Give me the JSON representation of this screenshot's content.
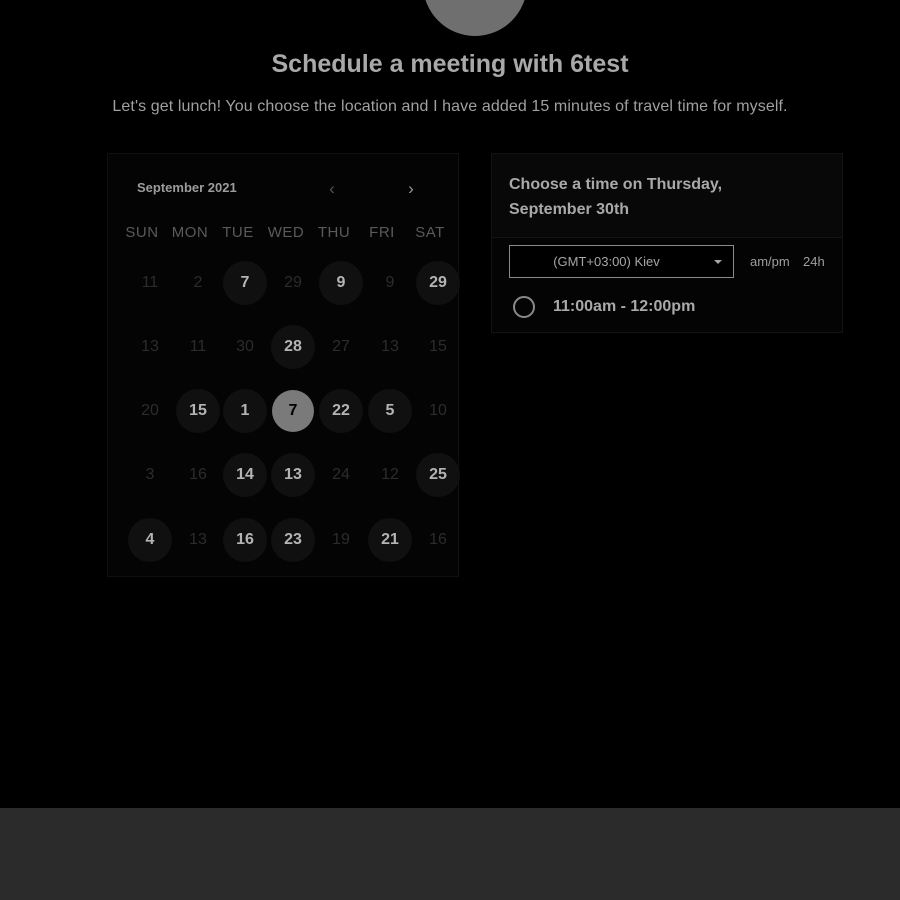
{
  "header": {
    "title": "Schedule a meeting with 6test",
    "subtitle": "Let's get lunch! You choose the location and I have added 15 minutes of travel time for myself."
  },
  "calendar": {
    "month_label": "September 2021",
    "prev_icon": "chevron-left-icon",
    "next_icon": "chevron-right-icon",
    "weekdays": [
      "SUN",
      "MON",
      "TUE",
      "WED",
      "THU",
      "FRI",
      "SAT"
    ],
    "weeks": [
      [
        {
          "d": "11",
          "s": "disabled"
        },
        {
          "d": "2",
          "s": "disabled"
        },
        {
          "d": "7",
          "s": "active"
        },
        {
          "d": "29",
          "s": "disabled"
        },
        {
          "d": "9",
          "s": "active"
        },
        {
          "d": "9",
          "s": "disabled"
        },
        {
          "d": "29",
          "s": "active"
        }
      ],
      [
        {
          "d": "13",
          "s": "disabled"
        },
        {
          "d": "11",
          "s": "disabled"
        },
        {
          "d": "30",
          "s": "disabled"
        },
        {
          "d": "28",
          "s": "active"
        },
        {
          "d": "27",
          "s": "disabled"
        },
        {
          "d": "13",
          "s": "disabled"
        },
        {
          "d": "15",
          "s": "disabled"
        }
      ],
      [
        {
          "d": "20",
          "s": "disabled"
        },
        {
          "d": "15",
          "s": "active"
        },
        {
          "d": "1",
          "s": "active"
        },
        {
          "d": "7",
          "s": "selected"
        },
        {
          "d": "22",
          "s": "active"
        },
        {
          "d": "5",
          "s": "active"
        },
        {
          "d": "10",
          "s": "disabled"
        }
      ],
      [
        {
          "d": "3",
          "s": "disabled"
        },
        {
          "d": "16",
          "s": "disabled"
        },
        {
          "d": "14",
          "s": "active"
        },
        {
          "d": "13",
          "s": "active"
        },
        {
          "d": "24",
          "s": "disabled"
        },
        {
          "d": "12",
          "s": "disabled"
        },
        {
          "d": "25",
          "s": "active"
        }
      ],
      [
        {
          "d": "4",
          "s": "active"
        },
        {
          "d": "13",
          "s": "disabled"
        },
        {
          "d": "16",
          "s": "active"
        },
        {
          "d": "23",
          "s": "active"
        },
        {
          "d": "19",
          "s": "disabled"
        },
        {
          "d": "21",
          "s": "active"
        },
        {
          "d": "16",
          "s": "disabled"
        }
      ]
    ]
  },
  "times": {
    "heading": "Choose a time on Thursday, September 30th",
    "timezone": "(GMT+03:00) Kiev",
    "format_ampm": "am/pm",
    "format_24h": "24h",
    "slots": [
      "11:00am - 12:00pm"
    ]
  },
  "colors": {
    "background": "#000000",
    "footer": "#2b2b2b",
    "selected_day": "#7a7a7a"
  }
}
